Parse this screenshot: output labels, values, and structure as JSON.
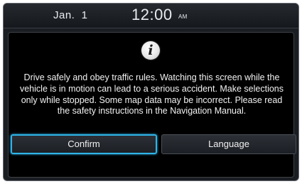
{
  "status_bar": {
    "date": "Jan.  1",
    "time": "12:00",
    "ampm": "AM"
  },
  "dialog": {
    "icon": "info-icon",
    "icon_glyph": "i",
    "message": "Drive safely and obey traffic rules. Watching this screen while the vehicle is in motion can lead to a serious accident. Make selections only while stopped. Some map data may be incorrect. Please read the safety instructions in the Navigation Manual.",
    "buttons": {
      "confirm": "Confirm",
      "language": "Language"
    }
  },
  "colors": {
    "focus_highlight": "#2fb4e8",
    "background": "#000000",
    "text": "#f2f2f2"
  }
}
